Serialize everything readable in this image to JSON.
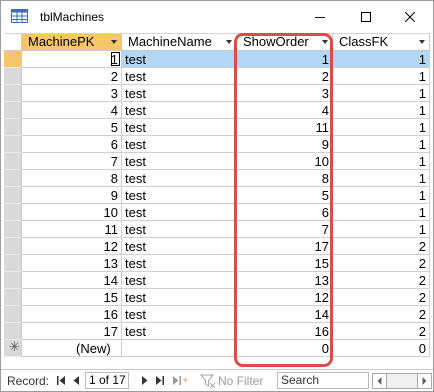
{
  "window": {
    "title": "tblMachines"
  },
  "columns": [
    {
      "label": "MachinePK"
    },
    {
      "label": "MachineName"
    },
    {
      "label": "ShowOrder"
    },
    {
      "label": "ClassFK"
    }
  ],
  "rows": [
    {
      "pk": "1",
      "name": "test",
      "show": "1",
      "cls": "1"
    },
    {
      "pk": "2",
      "name": "test",
      "show": "2",
      "cls": "1"
    },
    {
      "pk": "3",
      "name": "test",
      "show": "3",
      "cls": "1"
    },
    {
      "pk": "4",
      "name": "test",
      "show": "4",
      "cls": "1"
    },
    {
      "pk": "5",
      "name": "test",
      "show": "11",
      "cls": "1"
    },
    {
      "pk": "6",
      "name": "test",
      "show": "9",
      "cls": "1"
    },
    {
      "pk": "7",
      "name": "test",
      "show": "10",
      "cls": "1"
    },
    {
      "pk": "8",
      "name": "test",
      "show": "8",
      "cls": "1"
    },
    {
      "pk": "9",
      "name": "test",
      "show": "5",
      "cls": "1"
    },
    {
      "pk": "10",
      "name": "test",
      "show": "6",
      "cls": "1"
    },
    {
      "pk": "11",
      "name": "test",
      "show": "7",
      "cls": "1"
    },
    {
      "pk": "12",
      "name": "test",
      "show": "17",
      "cls": "2"
    },
    {
      "pk": "13",
      "name": "test",
      "show": "15",
      "cls": "2"
    },
    {
      "pk": "14",
      "name": "test",
      "show": "13",
      "cls": "2"
    },
    {
      "pk": "15",
      "name": "test",
      "show": "12",
      "cls": "2"
    },
    {
      "pk": "16",
      "name": "test",
      "show": "14",
      "cls": "2"
    },
    {
      "pk": "17",
      "name": "test",
      "show": "16",
      "cls": "2"
    }
  ],
  "new_row": {
    "pk": "(New)",
    "show": "0",
    "cls": "0"
  },
  "status": {
    "record_label": "Record:",
    "record_value": "1 of 17",
    "filter_label": "No Filter",
    "search_placeholder": "Search"
  },
  "colors": {
    "active_header": "#f7c66b",
    "selected_row": "#b2d6f4",
    "highlight_border": "#e04a4a"
  }
}
